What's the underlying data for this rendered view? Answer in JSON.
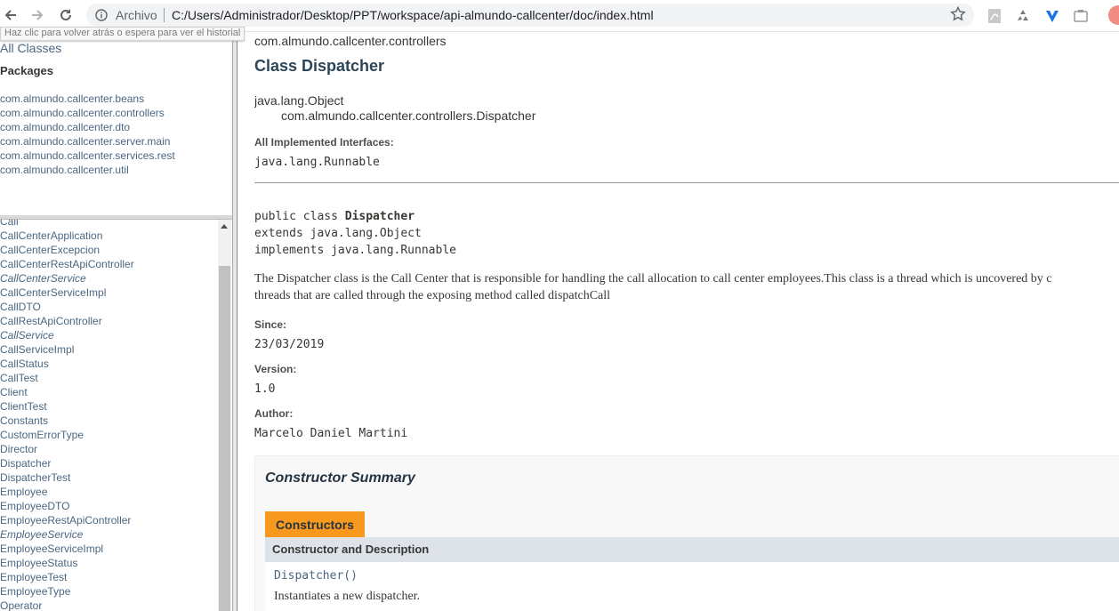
{
  "browser": {
    "url_scheme_label": "Archivo",
    "url": "C:/Users/Administrador/Desktop/PPT/workspace/api-almundo-callcenter/doc/index.html",
    "tooltip": "Haz clic para volver atrás o espera para ver el historial"
  },
  "packages_frame": {
    "all_classes": "All Classes",
    "title": "Packages",
    "items": [
      "com.almundo.callcenter.beans",
      "com.almundo.callcenter.controllers",
      "com.almundo.callcenter.dto",
      "com.almundo.callcenter.server.main",
      "com.almundo.callcenter.services.rest",
      "com.almundo.callcenter.util"
    ]
  },
  "classes_frame": {
    "items": [
      {
        "name": "Call",
        "interface": false
      },
      {
        "name": "CallCenterApplication",
        "interface": false
      },
      {
        "name": "CallCenterExcepcion",
        "interface": false
      },
      {
        "name": "CallCenterRestApiController",
        "interface": false
      },
      {
        "name": "CallCenterService",
        "interface": true
      },
      {
        "name": "CallCenterServiceImpl",
        "interface": false
      },
      {
        "name": "CallDTO",
        "interface": false
      },
      {
        "name": "CallRestApiController",
        "interface": false
      },
      {
        "name": "CallService",
        "interface": true
      },
      {
        "name": "CallServiceImpl",
        "interface": false
      },
      {
        "name": "CallStatus",
        "interface": false
      },
      {
        "name": "CallTest",
        "interface": false
      },
      {
        "name": "Client",
        "interface": false
      },
      {
        "name": "ClientTest",
        "interface": false
      },
      {
        "name": "Constants",
        "interface": false
      },
      {
        "name": "CustomErrorType",
        "interface": false
      },
      {
        "name": "Director",
        "interface": false
      },
      {
        "name": "Dispatcher",
        "interface": false
      },
      {
        "name": "DispatcherTest",
        "interface": false
      },
      {
        "name": "Employee",
        "interface": false
      },
      {
        "name": "EmployeeDTO",
        "interface": false
      },
      {
        "name": "EmployeeRestApiController",
        "interface": false
      },
      {
        "name": "EmployeeService",
        "interface": true
      },
      {
        "name": "EmployeeServiceImpl",
        "interface": false
      },
      {
        "name": "EmployeeStatus",
        "interface": false
      },
      {
        "name": "EmployeeTest",
        "interface": false
      },
      {
        "name": "EmployeeType",
        "interface": false
      },
      {
        "name": "Operator",
        "interface": false
      }
    ]
  },
  "main": {
    "package": "com.almundo.callcenter.controllers",
    "title": "Class Dispatcher",
    "inheritance_root": "java.lang.Object",
    "inheritance_class": "com.almundo.callcenter.controllers.Dispatcher",
    "interfaces_label": "All Implemented Interfaces:",
    "interfaces_value": "java.lang.Runnable",
    "signature": {
      "line1_prefix": "public class ",
      "line1_name": "Dispatcher",
      "line2": "extends java.lang.Object",
      "line3": "implements java.lang.Runnable"
    },
    "description_line1": "The Dispatcher class is the Call Center that is responsible for handling the call allocation to call center employees.This class is a thread which is uncovered by c",
    "description_line2": "threads that are called through the exposing method called dispatchCall",
    "since_label": "Since:",
    "since_value": "23/03/2019",
    "version_label": "Version:",
    "version_value": "1.0",
    "author_label": "Author:",
    "author_value": "Marcelo Daniel Martini",
    "constructor_summary": {
      "title": "Constructor Summary",
      "tab": "Constructors",
      "column_header": "Constructor and Description",
      "rows": [
        {
          "name": "Dispatcher",
          "params": "()",
          "description": "Instantiates a new dispatcher."
        }
      ]
    }
  }
}
